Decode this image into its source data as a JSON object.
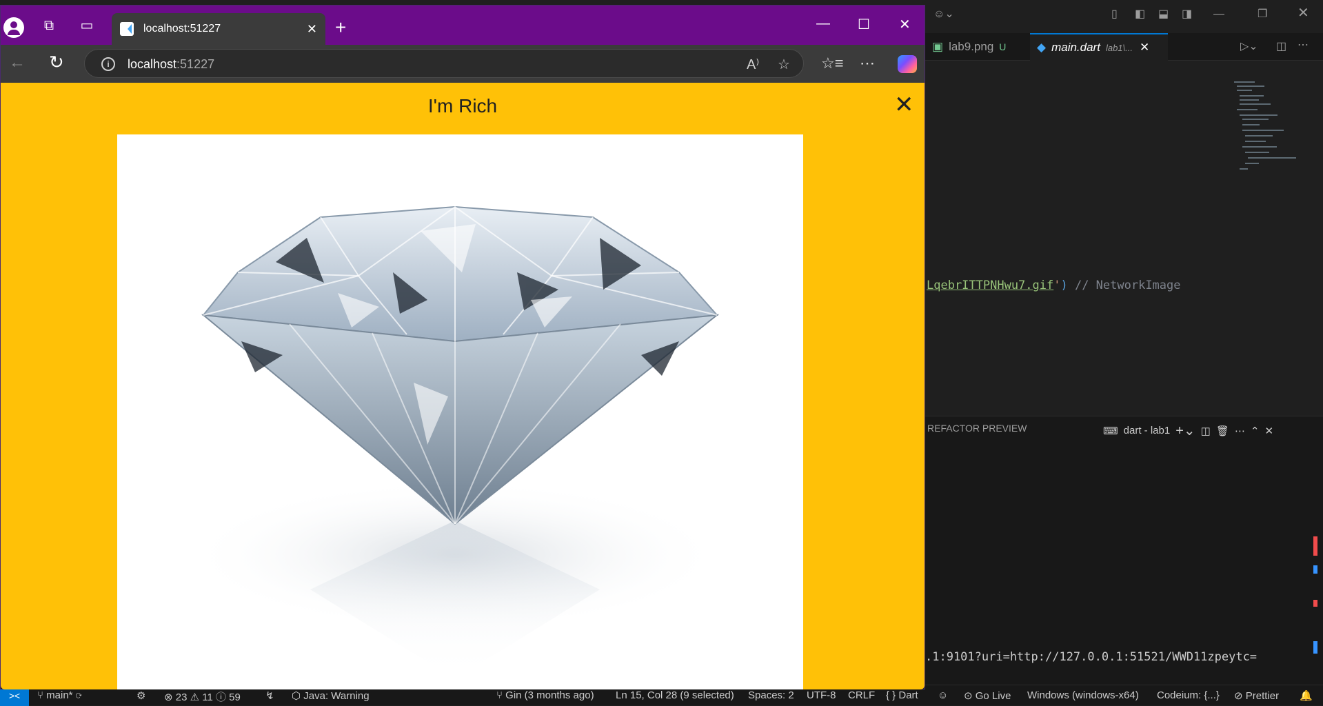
{
  "browser": {
    "tab": {
      "title": "localhost:51227"
    },
    "address": {
      "host": "localhost",
      "port": ":51227"
    }
  },
  "app": {
    "title": "I'm Rich",
    "image_subject": "diamond"
  },
  "vscode": {
    "tabs": [
      {
        "label": "lab9.png",
        "badge": "U"
      },
      {
        "label": "main.dart",
        "path": "lab1\\..."
      }
    ],
    "code_line": {
      "string_part": "LqebrITTPNHwu7.gif",
      "quote": "'",
      "paren": ")",
      "comment": " // NetworkImage"
    },
    "panel": {
      "title": "REFACTOR PREVIEW",
      "terminal_label": "dart - lab1",
      "output_line": ".1:9101?uri=http://127.0.0.1:51521/WWD11zpeytc="
    },
    "statusbar": {
      "branch": "main*",
      "problems": "23",
      "warnings": "11",
      "info": "59",
      "java": "Java: Warning",
      "git": "Gin (3 months ago)",
      "position": "Ln 15, Col 28 (9 selected)",
      "spaces": "Spaces: 2",
      "encoding": "UTF-8",
      "eol": "CRLF",
      "language": "Dart",
      "golive": "Go Live",
      "device": "Windows (windows-x64)",
      "codeium": "Codeium: {...}",
      "prettier": "Prettier"
    }
  },
  "colors": {
    "tabbar": "#6b0c8a",
    "appbar": "#ffc107",
    "vscode_bg": "#1f1f1f"
  }
}
